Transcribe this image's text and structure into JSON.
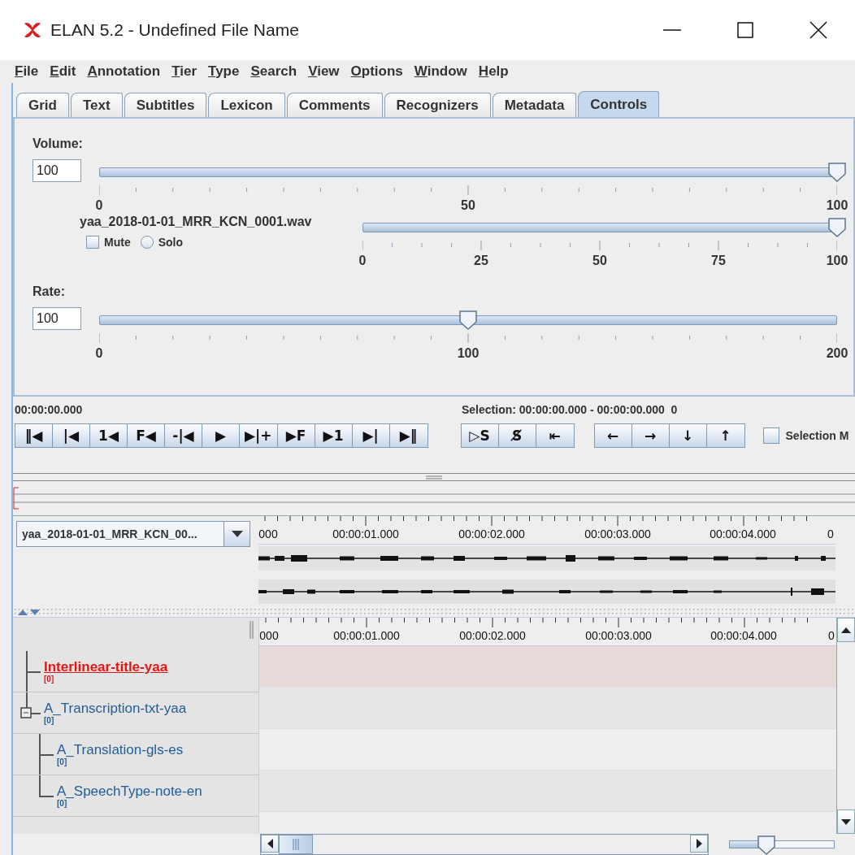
{
  "window": {
    "title": "ELAN 5.2 - Undefined File Name"
  },
  "menu": [
    "File",
    "Edit",
    "Annotation",
    "Tier",
    "Type",
    "Search",
    "View",
    "Options",
    "Window",
    "Help"
  ],
  "tabs": [
    {
      "label": "Grid",
      "selected": false
    },
    {
      "label": "Text",
      "selected": false
    },
    {
      "label": "Subtitles",
      "selected": false
    },
    {
      "label": "Lexicon",
      "selected": false
    },
    {
      "label": "Comments",
      "selected": false
    },
    {
      "label": "Recognizers",
      "selected": false
    },
    {
      "label": "Metadata",
      "selected": false
    },
    {
      "label": "Controls",
      "selected": true
    }
  ],
  "controls": {
    "volume": {
      "label": "Volume:",
      "value": "100",
      "level": 1,
      "ticks": [
        "0",
        "50",
        "100"
      ]
    },
    "track": {
      "name": "yaa_2018-01-01_MRR_KCN_0001.wav",
      "level": 1,
      "ticks": [
        "0",
        "25",
        "50",
        "75",
        "100"
      ],
      "mute": {
        "label": "Mute",
        "checked": false
      },
      "solo": {
        "label": "Solo",
        "selected": false
      }
    },
    "rate": {
      "label": "Rate:",
      "value": "100",
      "level": 0.5,
      "ticks": [
        "0",
        "100",
        "200"
      ]
    }
  },
  "media": {
    "time": "00:00:00.000",
    "selection": "Selection: 00:00:00.000 - 00:00:00.000  0",
    "transport": [
      "‖◀",
      "|◀",
      "1◀",
      "F◀",
      "-|◀",
      "▶",
      "▶|+",
      "▶F",
      "▶1",
      "▶|",
      "▶‖"
    ],
    "selection_buttons": [
      "▷S",
      "S̸",
      "⇤"
    ],
    "navigation": [
      "←",
      "→",
      "↓",
      "↑"
    ],
    "selection_mode": {
      "label": "Selection M",
      "checked": false
    }
  },
  "waveform": {
    "file": "yaa_2018-01-01_MRR_KCN_00...",
    "ruler": [
      "000",
      "00:00:01.000",
      "00:00:02.000",
      "00:00:03.000",
      "00:00:04.000",
      "0"
    ]
  },
  "tiers": {
    "ruler": [
      "000",
      "00:00:01.000",
      "00:00:02.000",
      "00:00:03.000",
      "00:00:04.000",
      "0"
    ],
    "items": [
      {
        "name": "Interlinear-title-yaa",
        "count": "[0]",
        "active": true
      },
      {
        "name": "A_Transcription-txt-yaa",
        "count": "[0]",
        "active": false,
        "expanded": true,
        "children": [
          {
            "name": "A_Translation-gls-es",
            "count": "[0]",
            "active": false
          },
          {
            "name": "A_SpeechType-note-en",
            "count": "[0]",
            "active": false
          }
        ]
      }
    ]
  },
  "zoom": {
    "level": 0.38
  }
}
